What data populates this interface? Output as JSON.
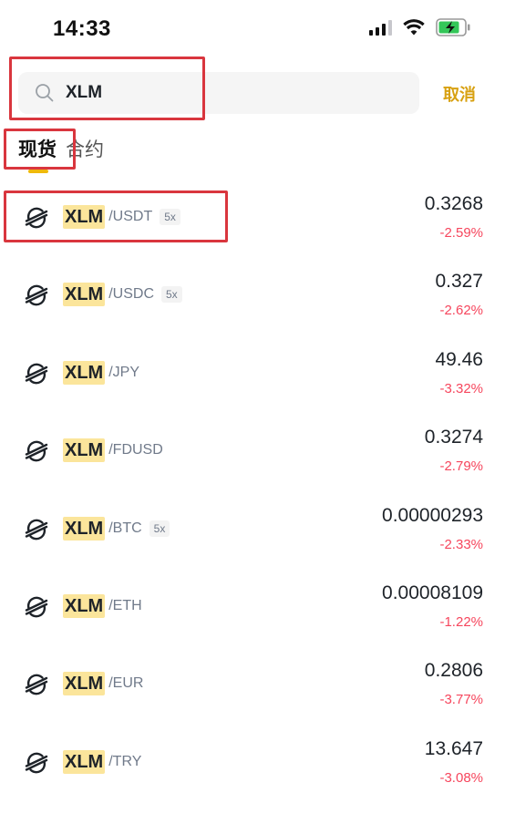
{
  "status_bar": {
    "time": "14:33"
  },
  "search": {
    "value": "XLM",
    "cancel_label": "取消"
  },
  "tabs": [
    {
      "label": "现货",
      "active": true
    },
    {
      "label": "合约",
      "active": false
    }
  ],
  "colors": {
    "accent": "#f0b90b",
    "negative": "#f6465d",
    "highlight": "#fbe59b",
    "annotation": "#d9363e"
  },
  "pairs": [
    {
      "base": "XLM",
      "quote": "/USDT",
      "leverage": "5x",
      "price": "0.3268",
      "change": "-2.59%"
    },
    {
      "base": "XLM",
      "quote": "/USDC",
      "leverage": "5x",
      "price": "0.327",
      "change": "-2.62%"
    },
    {
      "base": "XLM",
      "quote": "/JPY",
      "leverage": "",
      "price": "49.46",
      "change": "-3.32%"
    },
    {
      "base": "XLM",
      "quote": "/FDUSD",
      "leverage": "",
      "price": "0.3274",
      "change": "-2.79%"
    },
    {
      "base": "XLM",
      "quote": "/BTC",
      "leverage": "5x",
      "price": "0.00000293",
      "change": "-2.33%"
    },
    {
      "base": "XLM",
      "quote": "/ETH",
      "leverage": "",
      "price": "0.00008109",
      "change": "-1.22%"
    },
    {
      "base": "XLM",
      "quote": "/EUR",
      "leverage": "",
      "price": "0.2806",
      "change": "-3.77%"
    },
    {
      "base": "XLM",
      "quote": "/TRY",
      "leverage": "",
      "price": "13.647",
      "change": "-3.08%"
    }
  ]
}
